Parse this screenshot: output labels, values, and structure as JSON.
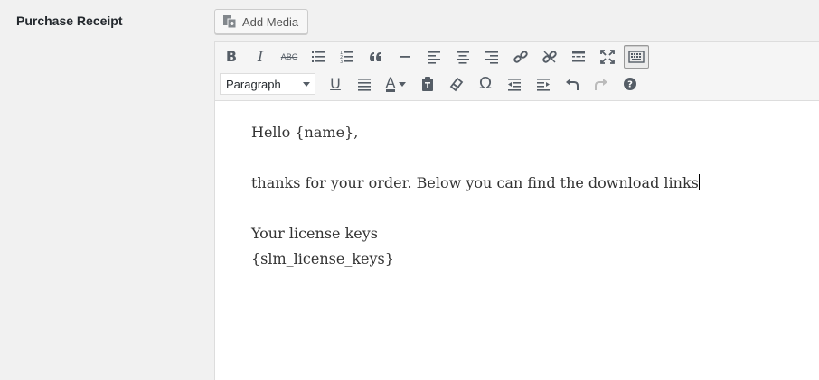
{
  "label": "Purchase Receipt",
  "add_media": {
    "label": "Add Media",
    "icon": "media-icon"
  },
  "toolbar": {
    "row1": [
      "bold-icon",
      "italic-icon",
      "strikethrough-icon",
      "bullet-list-icon",
      "numbered-list-icon",
      "blockquote-icon",
      "horizontal-line-icon",
      "align-left-icon",
      "align-center-icon",
      "align-right-icon",
      "link-icon",
      "unlink-icon",
      "read-more-icon",
      "fullscreen-icon",
      "toolbar-toggle-icon"
    ],
    "format_select": "Paragraph",
    "strikethrough_text": "ABC",
    "underline_glyph": "U",
    "text_color_glyph": "A",
    "special_char_glyph": "Ω",
    "help_glyph": "?",
    "text_color": "#555d66"
  },
  "content": {
    "greeting": "Hello {name},",
    "body": "thanks for your order. Below you can find the download links",
    "license_heading": "Your license keys",
    "license_placeholder": "{slm_license_keys}"
  }
}
